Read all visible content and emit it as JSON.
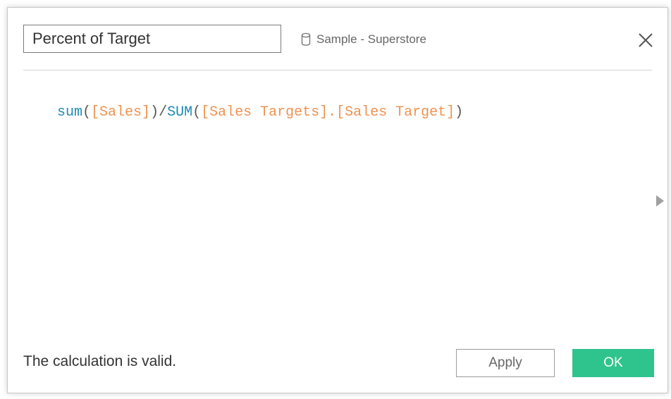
{
  "calc_name": {
    "value": "Percent of Target"
  },
  "datasource": {
    "label": "Sample - Superstore",
    "icon": "database-icon"
  },
  "close": {
    "icon": "close-icon"
  },
  "formula": {
    "tokens": [
      {
        "text": "sum",
        "kind": "function"
      },
      {
        "text": "(",
        "kind": "operator"
      },
      {
        "text": "[Sales]",
        "kind": "field"
      },
      {
        "text": ")/",
        "kind": "operator"
      },
      {
        "text": "SUM",
        "kind": "function"
      },
      {
        "text": "(",
        "kind": "operator"
      },
      {
        "text": "[Sales Targets].[Sales Target]",
        "kind": "field"
      },
      {
        "text": ")",
        "kind": "operator"
      }
    ]
  },
  "expand": {
    "icon": "expand-arrow-icon"
  },
  "status": {
    "text": "The calculation is valid."
  },
  "buttons": {
    "apply_label": "Apply",
    "ok_label": "OK"
  },
  "colors": {
    "function": "#1f8bb6",
    "field": "#ee9251",
    "ok_button": "#2fc48d"
  }
}
